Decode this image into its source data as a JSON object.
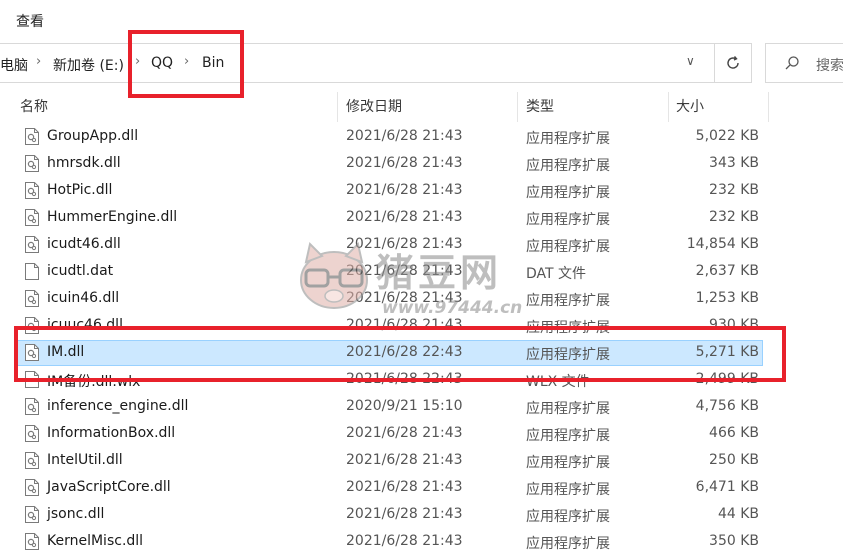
{
  "ribbon": {
    "tab_view": "查看"
  },
  "address": {
    "crumbs": [
      "电脑",
      "新加卷 (E:)",
      "QQ",
      "Bin"
    ],
    "search_placeholder": "搜索"
  },
  "columns": {
    "name": "名称",
    "date": "修改日期",
    "type": "类型",
    "size": "大小"
  },
  "files": [
    {
      "name": "GroupApp.dll",
      "date": "2021/6/28 21:43",
      "type": "应用程序扩展",
      "size": "5,022 KB",
      "icon": "dll-icon"
    },
    {
      "name": "hmrsdk.dll",
      "date": "2021/6/28 21:43",
      "type": "应用程序扩展",
      "size": "343 KB",
      "icon": "dll-icon"
    },
    {
      "name": "HotPic.dll",
      "date": "2021/6/28 21:43",
      "type": "应用程序扩展",
      "size": "232 KB",
      "icon": "dll-icon"
    },
    {
      "name": "HummerEngine.dll",
      "date": "2021/6/28 21:43",
      "type": "应用程序扩展",
      "size": "232 KB",
      "icon": "dll-icon"
    },
    {
      "name": "icudt46.dll",
      "date": "2021/6/28 21:43",
      "type": "应用程序扩展",
      "size": "14,854 KB",
      "icon": "dll-icon"
    },
    {
      "name": "icudtl.dat",
      "date": "2021/6/28 21:43",
      "type": "DAT 文件",
      "size": "2,637 KB",
      "icon": "file-icon"
    },
    {
      "name": "icuin46.dll",
      "date": "2021/6/28 21:43",
      "type": "应用程序扩展",
      "size": "1,253 KB",
      "icon": "dll-icon"
    },
    {
      "name": "icuuc46.dll",
      "date": "2021/6/28 21:43",
      "type": "应用程序扩展",
      "size": "930 KB",
      "icon": "dll-icon"
    },
    {
      "name": "IM.dll",
      "date": "2021/6/28 22:43",
      "type": "应用程序扩展",
      "size": "5,271 KB",
      "icon": "dll-icon",
      "selected": true
    },
    {
      "name": "IM备份.dll.wlx",
      "date": "2021/6/28 22:43",
      "type": "WLX 文件",
      "size": "2,499 KB",
      "icon": "file-icon"
    },
    {
      "name": "inference_engine.dll",
      "date": "2020/9/21 15:10",
      "type": "应用程序扩展",
      "size": "4,756 KB",
      "icon": "dll-icon"
    },
    {
      "name": "InformationBox.dll",
      "date": "2021/6/28 21:43",
      "type": "应用程序扩展",
      "size": "466 KB",
      "icon": "dll-icon"
    },
    {
      "name": "IntelUtil.dll",
      "date": "2021/6/28 21:43",
      "type": "应用程序扩展",
      "size": "250 KB",
      "icon": "dll-icon"
    },
    {
      "name": "JavaScriptCore.dll",
      "date": "2021/6/28 21:43",
      "type": "应用程序扩展",
      "size": "6,471 KB",
      "icon": "dll-icon"
    },
    {
      "name": "jsonc.dll",
      "date": "2021/6/28 21:43",
      "type": "应用程序扩展",
      "size": "44 KB",
      "icon": "dll-icon"
    },
    {
      "name": "KernelMisc.dll",
      "date": "2021/6/28 21:43",
      "type": "应用程序扩展",
      "size": "350 KB",
      "icon": "dll-icon"
    }
  ],
  "watermark": {
    "text": "猪豆网",
    "url": "www.97444.cn"
  },
  "colors": {
    "annotation": "#e8212b",
    "selection": "#cce8ff"
  }
}
